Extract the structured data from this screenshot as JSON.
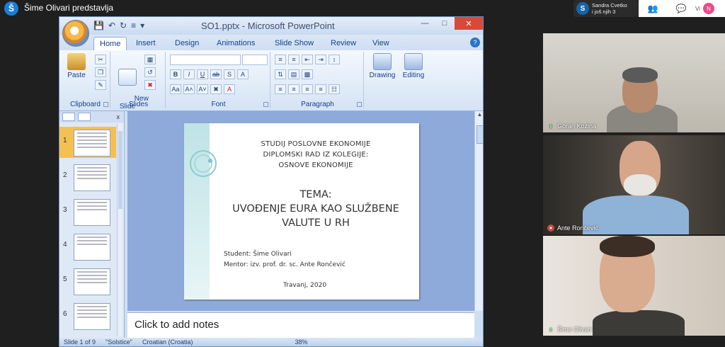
{
  "meeting": {
    "presenter_initial": "Š",
    "presenter_text": "Šime Olivari predstavlja",
    "participants_initial": "S",
    "participants_line1": "Sandra Cvetko",
    "participants_line2": "i još njih 3",
    "self_label": "Vi",
    "self_initial": "N"
  },
  "ppt": {
    "window_title": "SO1.pptx - Microsoft PowerPoint",
    "tabs": [
      "Home",
      "Insert",
      "Design",
      "Animations",
      "Slide Show",
      "Review",
      "View"
    ],
    "active_tab": "Home",
    "ribbon": {
      "paste_label": "Paste",
      "new_slide_label": "New\nSlide",
      "drawing_label": "Drawing",
      "editing_label": "Editing",
      "groups": [
        "Clipboard",
        "Slides",
        "Font",
        "Paragraph"
      ]
    },
    "thumbnails": [
      "1",
      "2",
      "3",
      "4",
      "5",
      "6"
    ],
    "slide": {
      "header_lines": [
        "STUDIJ POSLOVNE EKONOMIJE",
        "DIPLOMSKI RAD IZ KOLEGIJE:",
        "OSNOVE EKONOMIJE"
      ],
      "title_lines": [
        "TEMA:",
        "UVOĐENJE EURA KAO SLUŽBENE",
        "VALUTE U RH"
      ],
      "student": "Student: Šime Olivari",
      "mentor": "Mentor: izv. prof. dr. sc.  Ante Rončević",
      "date": "Travanj, 2020"
    },
    "notes_placeholder": "Click to add notes",
    "status": {
      "slide_info": "Slide 1 of 9",
      "theme": "\"Solstice\"",
      "language": "Croatian (Croatia)",
      "zoom": "38%"
    }
  },
  "participants": [
    {
      "name": "Goran Kozina",
      "mic": "on"
    },
    {
      "name": "Ante Rončević",
      "mic": "off"
    },
    {
      "name": "Šime Olivari",
      "mic": "on"
    }
  ]
}
